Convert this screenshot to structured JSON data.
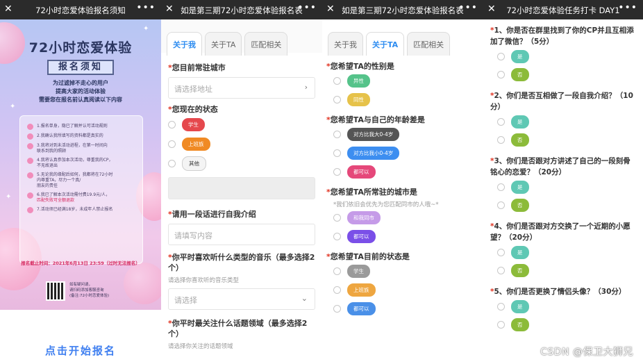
{
  "screen1": {
    "title": "72小时恋爱体验报名须知",
    "poster_title": "72小时恋爱体验",
    "poster_sub": "报名须知",
    "intro": [
      "为过滤掉不走心的用户",
      "提高大家的活动体验",
      "需要您在报名前认真阅读以下内容"
    ],
    "rules": [
      {
        "text": "1.报名单身，隐已了解并认可活动规则"
      },
      {
        "text": "2.我确认我所填写的资料都是真实的"
      },
      {
        "text": "3.我将对到未活动进程，在第一时间向",
        "text2": "联系到我的照顾"
      },
      {
        "text": "4.我将认真参加本次活动，尊重我的CP，",
        "text2": "不无故退出"
      },
      {
        "text": "5.无论我的缘配后如何，我都将在72小时",
        "text2": "内尊重TA，尽力一个真/",
        "text3": "朋友的责任"
      },
      {
        "text": "6.我已了解本次活动需付费19.9元/人，",
        "red": "匹配失败可全额退款"
      },
      {
        "text": "7.活动须已经满18岁，未成年人禁止报名"
      }
    ],
    "deadline": "报名截止时间：2021年6月13日 23:59（过时无法报名）",
    "qr_note": [
      "如有疑问请，",
      "请扫码添加客服咨询",
      "(备注:72小时恋爱体验)"
    ],
    "cta": "点击开始报名"
  },
  "screen2": {
    "title": "如是第三期72小时恋爱体验报名表",
    "tabs": [
      "关于我",
      "关于TA",
      "匹配相关"
    ],
    "q1": "您目前常驻城市",
    "q1_placeholder": "请选择地址",
    "q2": "您现在的状态",
    "q2_options": [
      {
        "label": "学生",
        "color": "#e5484d"
      },
      {
        "label": "上班族",
        "color": "#f08a24"
      },
      {
        "label": "其他",
        "color": ""
      }
    ],
    "q3": "请用一段话进行自我介绍",
    "q3_placeholder": "请填写内容",
    "q4": "你平时喜欢听什么类型的音乐（最多选择2个）",
    "q4_hint": "请选择你喜欢听的音乐类型",
    "q4_placeholder": "请选择",
    "q5": "你平时最关注什么话题领域（最多选择2个）",
    "q5_hint": "请选择你关注的话题领域"
  },
  "screen3": {
    "title": "如是第三期72小时恋爱体验报名表",
    "tabs": [
      "关于我",
      "关于TA",
      "匹配相关"
    ],
    "q1": "您希望TA的性别是",
    "q1_options": [
      {
        "label": "异性",
        "color": "#55c38a"
      },
      {
        "label": "同性",
        "color": "#e6c24a"
      }
    ],
    "q2": "您希望TA与自己的年龄差是",
    "q2_options": [
      {
        "label": "对方比我大0-4岁",
        "color": "#555555"
      },
      {
        "label": "对方比我小0-4岁",
        "color": "#3d8ef0"
      },
      {
        "label": "都可以",
        "color": "#e5487a"
      }
    ],
    "q3": "您希望TA所常驻的城市是",
    "q3_hint": "*我们依旧会优先为您匹配同市的人哦~*",
    "q3_options": [
      {
        "label": "和我同市",
        "color": "#c59be8"
      },
      {
        "label": "都可以",
        "color": "#7a4fe8"
      }
    ],
    "q4": "您希望TA目前的状态是",
    "q4_options": [
      {
        "label": "学生",
        "color": "#9a9a9a"
      },
      {
        "label": "上班族",
        "color": "#eea640"
      },
      {
        "label": "都可以",
        "color": "#4a90e8"
      }
    ]
  },
  "screen4": {
    "title": "72小时恋爱体验任务打卡 DAY1",
    "questions": [
      "1、你是否在群里找到了你的CP并且互相添加了微信？（5分）",
      "2、你们是否互相做了一段自我介绍？（10分）",
      "3、你们是否跟对方讲述了自己的一段刻骨铭心的恋爱？（20分）",
      "4、你们是否跟对方交换了一个近期的小愿望？（20分）",
      "5、你们是否更换了情侣头像？（30分）"
    ],
    "yes_label": "是",
    "no_label": "否",
    "watermark": "CSDN @保卫大狮兄"
  },
  "icons": {
    "close": "close-icon",
    "more": "more-icon",
    "arrow": "chevron-right-icon",
    "dropdown": "chevron-down-icon"
  }
}
